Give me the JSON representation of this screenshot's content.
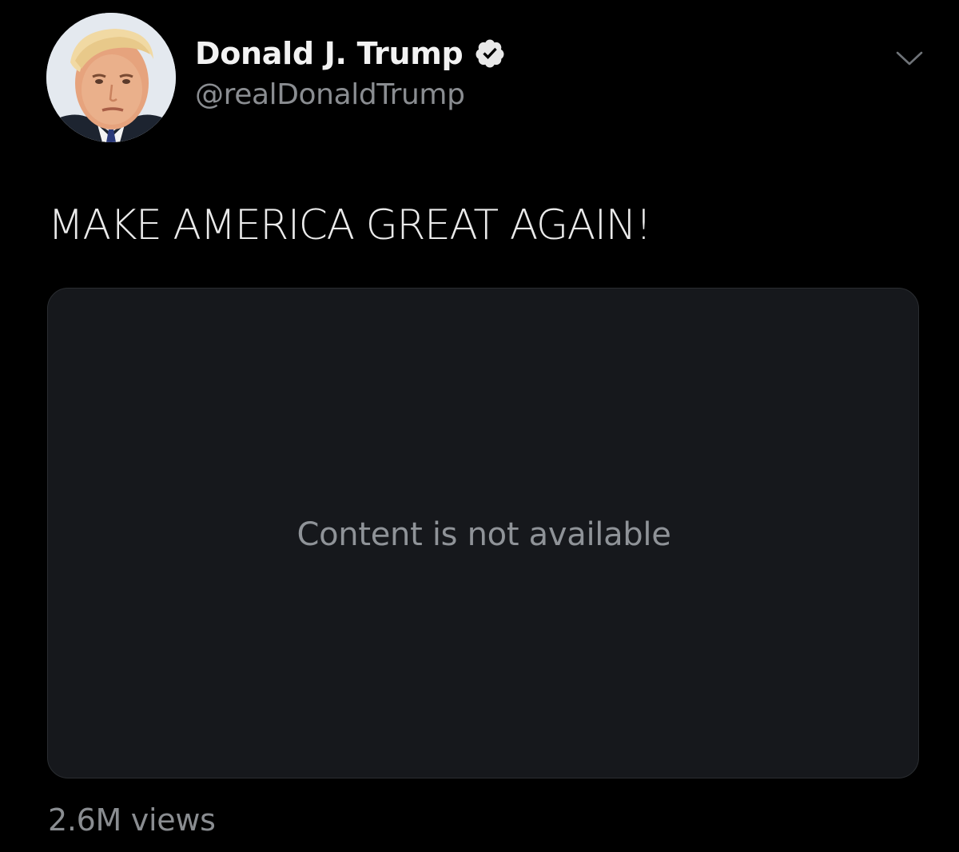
{
  "tweet": {
    "author": {
      "display_name": "Donald J. Trump",
      "handle": "@realDonaldTrump",
      "verified": true,
      "avatar_icon": "profile-photo"
    },
    "menu_icon": "chevron-down-icon",
    "text": "MAKE AMERICA GREAT AGAIN!",
    "media": {
      "message": "Content is not available"
    },
    "views": "2.6M views"
  },
  "colors": {
    "background": "#000000",
    "text_primary": "#eaeaea",
    "text_secondary": "#8a8d91",
    "media_card_bg": "#16181c",
    "verified_badge": "#e8e8e8"
  }
}
